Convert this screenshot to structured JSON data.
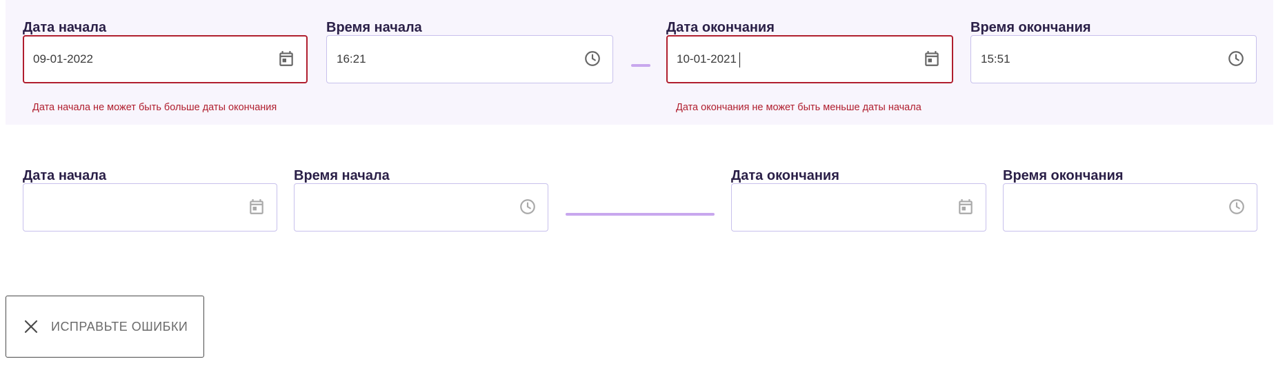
{
  "top_form": {
    "start_date": {
      "label": "Дата начала",
      "value": "09-01-2022",
      "error": "Дата начала не может быть больше даты окончания",
      "icon": "calendar-icon"
    },
    "start_time": {
      "label": "Время начала",
      "value": "16:21",
      "icon": "clock-icon"
    },
    "end_date": {
      "label": "Дата окончания",
      "value": "10-01-2021",
      "error": "Дата окончания не может быть меньше даты начала",
      "icon": "calendar-icon"
    },
    "end_time": {
      "label": "Время окончания",
      "value": "15:51",
      "icon": "clock-icon"
    }
  },
  "bottom_form": {
    "start_date": {
      "label": "Дата начала",
      "value": "",
      "icon": "calendar-icon"
    },
    "start_time": {
      "label": "Время начала",
      "value": "",
      "icon": "clock-icon"
    },
    "end_date": {
      "label": "Дата окончания",
      "value": "",
      "icon": "calendar-icon"
    },
    "end_time": {
      "label": "Время окончания",
      "value": "",
      "icon": "clock-icon"
    }
  },
  "submit": {
    "label": "ИСПРАВЬТЕ ОШИБКИ",
    "icon": "close-icon"
  },
  "colors": {
    "panel_background": "#f8f5fd",
    "error": "#b01e2e",
    "input_border": "#c7c0ec",
    "label": "#2a1f47",
    "dash": "#c8a7ee"
  }
}
